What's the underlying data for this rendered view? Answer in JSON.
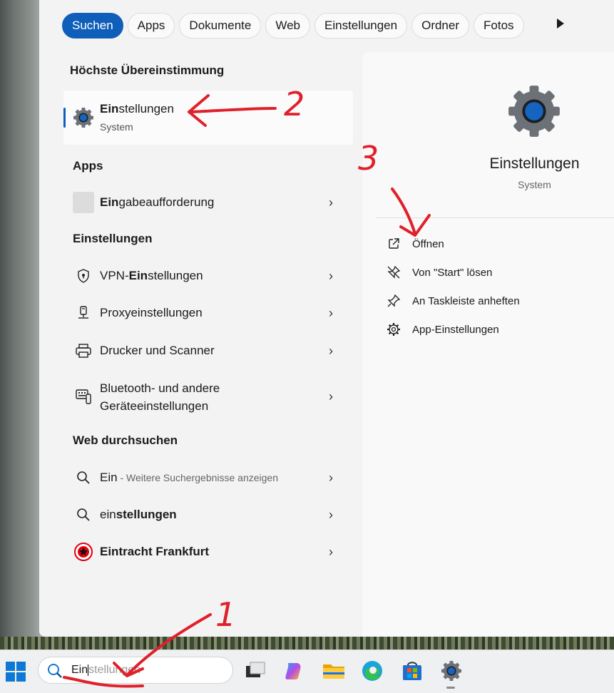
{
  "filters": [
    "Suchen",
    "Apps",
    "Dokumente",
    "Web",
    "Einstellungen",
    "Ordner",
    "Fotos"
  ],
  "best_match": {
    "heading": "Höchste Übereinstimmung",
    "title_bold": "Ein",
    "title_rest": "stellungen",
    "subtitle": "System",
    "icon": "gear-icon"
  },
  "apps": {
    "heading": "Apps",
    "items": [
      {
        "bold": "Ein",
        "rest": "gabeaufforderung"
      }
    ]
  },
  "settings": {
    "heading": "Einstellungen",
    "items": [
      {
        "pre": "VPN-",
        "bold": "Ein",
        "rest": "stellungen",
        "icon": "shield-icon"
      },
      {
        "pre": "Proxyeinstellungen",
        "bold": "",
        "rest": "",
        "icon": "proxy-icon"
      },
      {
        "pre": "Drucker und Scanner",
        "bold": "",
        "rest": "",
        "icon": "printer-icon"
      },
      {
        "line1": "Bluetooth- und andere",
        "line2": "Geräteeinstellungen",
        "icon": "devices-icon"
      }
    ]
  },
  "web": {
    "heading": "Web durchsuchen",
    "items": [
      {
        "pre": "Ein",
        "hint": " - Weitere Suchergebnisse anzeigen"
      },
      {
        "pre": "ein",
        "bold": "stellungen"
      },
      {
        "bold1": "Ein",
        "bold2": "tracht Frankfurt"
      }
    ]
  },
  "detail": {
    "title": "Einstellungen",
    "subtitle": "System",
    "actions": [
      {
        "label": "Öffnen",
        "icon": "open-external-icon"
      },
      {
        "label": "Von \"Start\" lösen",
        "icon": "unpin-icon"
      },
      {
        "label": "An Taskleiste anheften",
        "icon": "pin-icon"
      },
      {
        "label": "App-Einstellungen",
        "icon": "gear-icon"
      }
    ]
  },
  "taskbar": {
    "search_typed": "Ein",
    "search_suggest": "stellungen"
  },
  "annotations": [
    "1",
    "2",
    "3"
  ],
  "colors": {
    "accent": "#0f5fba",
    "annotation": "#e0202a"
  }
}
